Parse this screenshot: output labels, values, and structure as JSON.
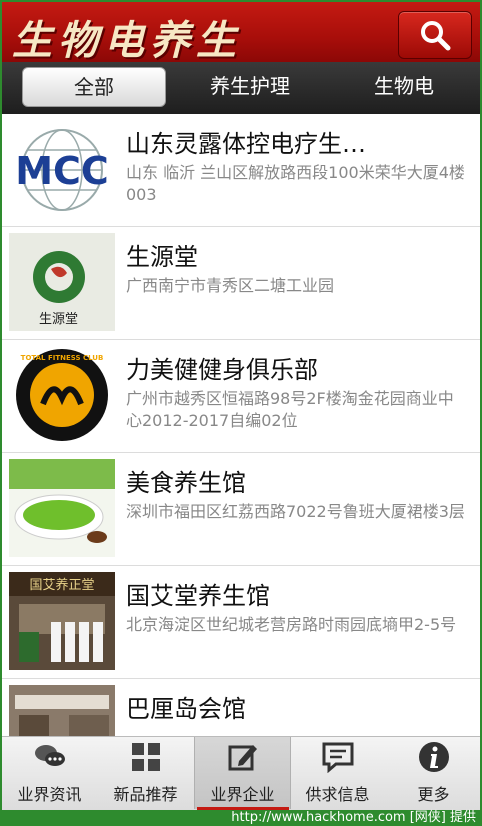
{
  "header": {
    "title": "生物电养生"
  },
  "tabs": [
    "全部",
    "养生护理",
    "生物电"
  ],
  "list": [
    {
      "name": "山东灵露体控电疗生…",
      "address": "山东 临沂 兰山区解放路西段100米荣华大厦4楼003",
      "thumb_text": "MCC"
    },
    {
      "name": "生源堂",
      "address": "广西南宁市青秀区二塘工业园",
      "thumb_text": "生源堂"
    },
    {
      "name": "力美健健身俱乐部",
      "address": "广州市越秀区恒福路98号2F楼淘金花园商业中心2012-2017自编02位",
      "thumb_text": "TOTAL FITNESS CLUB"
    },
    {
      "name": "美食养生馆",
      "address": "深圳市福田区红荔西路7022号鲁班大厦裙楼3层",
      "thumb_text": ""
    },
    {
      "name": "国艾堂养生馆",
      "address": "北京海淀区世纪城老营房路时雨园底墒甲2-5号",
      "thumb_text": "国艾养正堂"
    },
    {
      "name": "巴厘岛会馆",
      "address": "",
      "thumb_text": ""
    }
  ],
  "bottom_nav": [
    "业界资讯",
    "新品推荐",
    "业界企业",
    "供求信息",
    "更多"
  ],
  "footer": "http://www.hackhome.com [网侠] 提供",
  "colors": {
    "header_red": "#c41a12",
    "page_green": "#2e8b2e"
  }
}
